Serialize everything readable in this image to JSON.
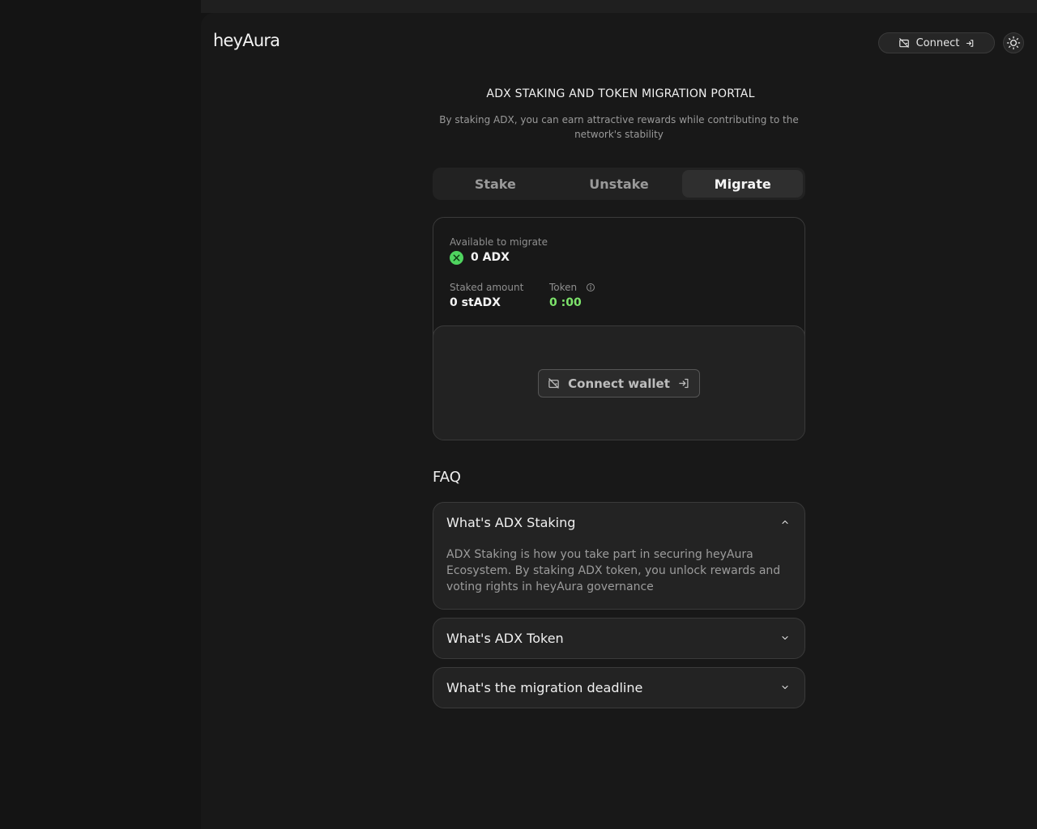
{
  "header": {
    "logo": "heyAura",
    "connect_label": "Connect"
  },
  "hero": {
    "title": "ADX STAKING AND TOKEN MIGRATION PORTAL",
    "subtitle": "By staking ADX, you can earn attractive rewards while contributing to the network's stability"
  },
  "tabs": [
    {
      "label": "Stake",
      "active": false
    },
    {
      "label": "Unstake",
      "active": false
    },
    {
      "label": "Migrate",
      "active": true
    }
  ],
  "migrate_card": {
    "available_label": "Available to migrate",
    "available_value": "0 ADX",
    "staked_label": "Staked amount",
    "staked_value": "0 stADX",
    "token_label": "Token",
    "token_value": "0 :00",
    "connect_wallet_label": "Connect wallet"
  },
  "faq": {
    "title": "FAQ",
    "items": [
      {
        "question": "What's ADX Staking",
        "expanded": true,
        "answer": "ADX Staking is how you take part in securing heyAura Ecosystem. By staking ADX token, you unlock rewards and voting rights in heyAura governance"
      },
      {
        "question": "What's ADX Token",
        "expanded": false
      },
      {
        "question": "What's the migration deadline",
        "expanded": false
      }
    ]
  },
  "colors": {
    "background": "#141414",
    "accent_green": "#7de36b",
    "adx_badge": "#4fd45f"
  },
  "icons": [
    "wallet-off-icon",
    "login-icon",
    "sun-icon",
    "adx-token-icon",
    "info-icon",
    "chevron-up-icon",
    "chevron-down-icon"
  ]
}
